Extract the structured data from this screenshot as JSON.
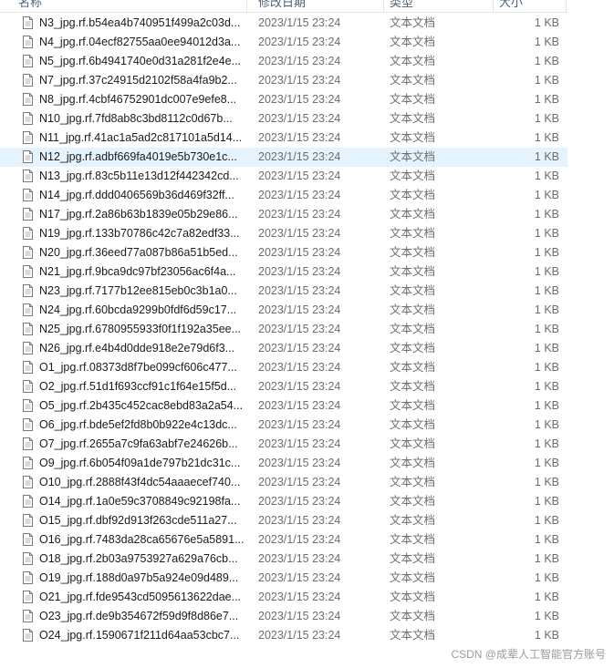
{
  "header": {
    "name": "名称",
    "date": "修改日期",
    "type": "类型",
    "size": "大小"
  },
  "rows": [
    {
      "name": "N3_jpg.rf.b54ea4b740951f499a2c03d...",
      "date": "2023/1/15 23:24",
      "type": "文本文档",
      "size": "1 KB"
    },
    {
      "name": "N4_jpg.rf.04ecf82755aa0ee94012d3a...",
      "date": "2023/1/15 23:24",
      "type": "文本文档",
      "size": "1 KB"
    },
    {
      "name": "N5_jpg.rf.6b4941740e0d31a281f2e4e...",
      "date": "2023/1/15 23:24",
      "type": "文本文档",
      "size": "1 KB"
    },
    {
      "name": "N7_jpg.rf.37c24915d2102f58a4fa9b2...",
      "date": "2023/1/15 23:24",
      "type": "文本文档",
      "size": "1 KB"
    },
    {
      "name": "N8_jpg.rf.4cbf46752901dc007e9efe8...",
      "date": "2023/1/15 23:24",
      "type": "文本文档",
      "size": "1 KB"
    },
    {
      "name": "N10_jpg.rf.7fd8ab8c3bd8112c0d67b...",
      "date": "2023/1/15 23:24",
      "type": "文本文档",
      "size": "1 KB"
    },
    {
      "name": "N11_jpg.rf.41ac1a5ad2c817101a5d14...",
      "date": "2023/1/15 23:24",
      "type": "文本文档",
      "size": "1 KB"
    },
    {
      "name": "N12_jpg.rf.adbf669fa4019e5b730e1c...",
      "date": "2023/1/15 23:24",
      "type": "文本文档",
      "size": "1 KB",
      "selected": true
    },
    {
      "name": "N13_jpg.rf.83c5b11e13d12f442342cd...",
      "date": "2023/1/15 23:24",
      "type": "文本文档",
      "size": "1 KB"
    },
    {
      "name": "N14_jpg.rf.ddd0406569b36d469f32ff...",
      "date": "2023/1/15 23:24",
      "type": "文本文档",
      "size": "1 KB"
    },
    {
      "name": "N17_jpg.rf.2a86b63b1839e05b29e86...",
      "date": "2023/1/15 23:24",
      "type": "文本文档",
      "size": "1 KB"
    },
    {
      "name": "N19_jpg.rf.133b70786c42c7a82edf33...",
      "date": "2023/1/15 23:24",
      "type": "文本文档",
      "size": "1 KB"
    },
    {
      "name": "N20_jpg.rf.36eed77a087b86a51b5ed...",
      "date": "2023/1/15 23:24",
      "type": "文本文档",
      "size": "1 KB"
    },
    {
      "name": "N21_jpg.rf.9bca9dc97bf23056ac6f4a...",
      "date": "2023/1/15 23:24",
      "type": "文本文档",
      "size": "1 KB"
    },
    {
      "name": "N23_jpg.rf.7177b12ee815eb0c3b1a0...",
      "date": "2023/1/15 23:24",
      "type": "文本文档",
      "size": "1 KB"
    },
    {
      "name": "N24_jpg.rf.60bcda9299b0fdf6d59c17...",
      "date": "2023/1/15 23:24",
      "type": "文本文档",
      "size": "1 KB"
    },
    {
      "name": "N25_jpg.rf.6780955933f0f1f192a35ee...",
      "date": "2023/1/15 23:24",
      "type": "文本文档",
      "size": "1 KB"
    },
    {
      "name": "N26_jpg.rf.e4b4d0dde918e2e79d6f3...",
      "date": "2023/1/15 23:24",
      "type": "文本文档",
      "size": "1 KB"
    },
    {
      "name": "O1_jpg.rf.08373d8f7be099cf606c477...",
      "date": "2023/1/15 23:24",
      "type": "文本文档",
      "size": "1 KB"
    },
    {
      "name": "O2_jpg.rf.51d1f693ccf91c1f64e15f5d...",
      "date": "2023/1/15 23:24",
      "type": "文本文档",
      "size": "1 KB"
    },
    {
      "name": "O5_jpg.rf.2b435c452cac8ebd83a2a54...",
      "date": "2023/1/15 23:24",
      "type": "文本文档",
      "size": "1 KB"
    },
    {
      "name": "O6_jpg.rf.bde5ef2fd8b0b922e4c13dc...",
      "date": "2023/1/15 23:24",
      "type": "文本文档",
      "size": "1 KB"
    },
    {
      "name": "O7_jpg.rf.2655a7c9fa63abf7e24626b...",
      "date": "2023/1/15 23:24",
      "type": "文本文档",
      "size": "1 KB"
    },
    {
      "name": "O9_jpg.rf.6b054f09a1de797b21dc31c...",
      "date": "2023/1/15 23:24",
      "type": "文本文档",
      "size": "1 KB"
    },
    {
      "name": "O10_jpg.rf.2888f43f4dc54aaaecef740...",
      "date": "2023/1/15 23:24",
      "type": "文本文档",
      "size": "1 KB"
    },
    {
      "name": "O14_jpg.rf.1a0e59c3708849c92198fa...",
      "date": "2023/1/15 23:24",
      "type": "文本文档",
      "size": "1 KB"
    },
    {
      "name": "O15_jpg.rf.dbf92d913f263cde511a27...",
      "date": "2023/1/15 23:24",
      "type": "文本文档",
      "size": "1 KB"
    },
    {
      "name": "O16_jpg.rf.7483da28ca65676e5a5891...",
      "date": "2023/1/15 23:24",
      "type": "文本文档",
      "size": "1 KB"
    },
    {
      "name": "O18_jpg.rf.2b03a9753927a629a76cb...",
      "date": "2023/1/15 23:24",
      "type": "文本文档",
      "size": "1 KB"
    },
    {
      "name": "O19_jpg.rf.188d0a97b5a924e09d489...",
      "date": "2023/1/15 23:24",
      "type": "文本文档",
      "size": "1 KB"
    },
    {
      "name": "O21_jpg.rf.fde9543cd5095613622dae...",
      "date": "2023/1/15 23:24",
      "type": "文本文档",
      "size": "1 KB"
    },
    {
      "name": "O23_jpg.rf.de9b354672f59d9f8d86e7...",
      "date": "2023/1/15 23:24",
      "type": "文本文档",
      "size": "1 KB"
    },
    {
      "name": "O24_jpg.rf.1590671f211d64aa53cbc7...",
      "date": "2023/1/15 23:24",
      "type": "文本文档",
      "size": "1 KB"
    }
  ],
  "watermark": "CSDN @成辈人工智能官方账号",
  "colors": {
    "selected_row": "#e5f3ff",
    "meta_text": "#6d6d6d"
  },
  "icons": {
    "file": "text-document-icon"
  }
}
